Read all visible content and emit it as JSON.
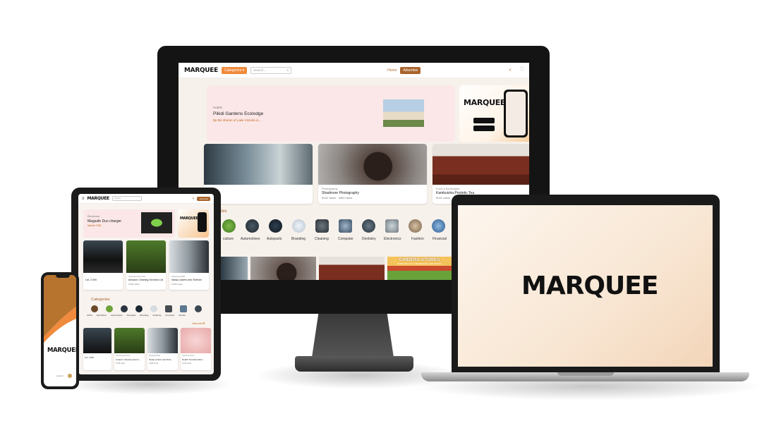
{
  "brand": {
    "logo": "MARQUEE",
    "accent": "#f08a3c",
    "accent_dark": "#a9642c"
  },
  "desktop": {
    "nav": {
      "categories_label": "Categories",
      "search_placeholder": "Search...",
      "home": "Home",
      "advertise": "Advertise"
    },
    "hero": {
      "category": "Hotels",
      "title": "Pikidi Gardens Ecolodge",
      "subtitle": "By the shores of Lake Victoria in..."
    },
    "cards": [
      {
        "category": "",
        "title": "",
        "meta": ""
      },
      {
        "category": "Photography",
        "title": "Shadmore Photography",
        "meta": "5042 views · 4005 clicks"
      },
      {
        "category": "Food & Beverages",
        "title": "Kambuisha Prodetic Tea",
        "meta": "5042 views · 4207 clicks"
      }
    ],
    "categories_heading": "ries",
    "categories": [
      "culture",
      "Automotives",
      "Autoparts",
      "Branding",
      "Cleaning",
      "Computer",
      "Dentistry",
      "Electronics",
      "Fashion",
      "Financial"
    ],
    "banner_text": "CHIDERA STORES",
    "banner_sub": "SUPPLIER IN ALL BEVERAGES AND FRUITS"
  },
  "laptop": {
    "logo": "MARQUEE"
  },
  "tablet": {
    "logo": "MARQUEE",
    "search_placeholder": "Search",
    "advertise": "Advertise",
    "hero": {
      "category": "Electronics",
      "title": "Magsafe Duo charger",
      "subtitle": "Nairobi CBD"
    },
    "promo_logo": "MARQUEE",
    "cards_row1": [
      {
        "category": "",
        "title": "Ltd. 2.00h",
        "meta": ""
      },
      {
        "category": "Cleaning Services",
        "title": "Amazon Cleaning Services Ltd",
        "meta": "5,350 views"
      },
      {
        "category": "Shopping Mall",
        "title": "Naraj Lockers and Shelves",
        "meta": "5,350 views"
      }
    ],
    "categories_heading": "Categories",
    "categories": [
      "Africa",
      "Agriculture",
      "Automotives",
      "Autoparts",
      "Branding",
      "Cleaning",
      "Computer",
      "Dentist"
    ],
    "view_all": "View All",
    "cards_row2": [
      {
        "category": "",
        "title": "Ltd. 2.00h",
        "meta": ""
      },
      {
        "category": "Cleaning Services",
        "title": "Amazon Cleaning Servic...",
        "meta": "5,350 views"
      },
      {
        "category": "Shopping Mall",
        "title": "Naraj Lockers and Shel...",
        "meta": "4,835 views"
      },
      {
        "category": "Health Services",
        "title": "Health Transformation",
        "meta": "5,213 views"
      }
    ]
  },
  "phone": {
    "logo": "MARQUEE",
    "footer": "powered"
  }
}
